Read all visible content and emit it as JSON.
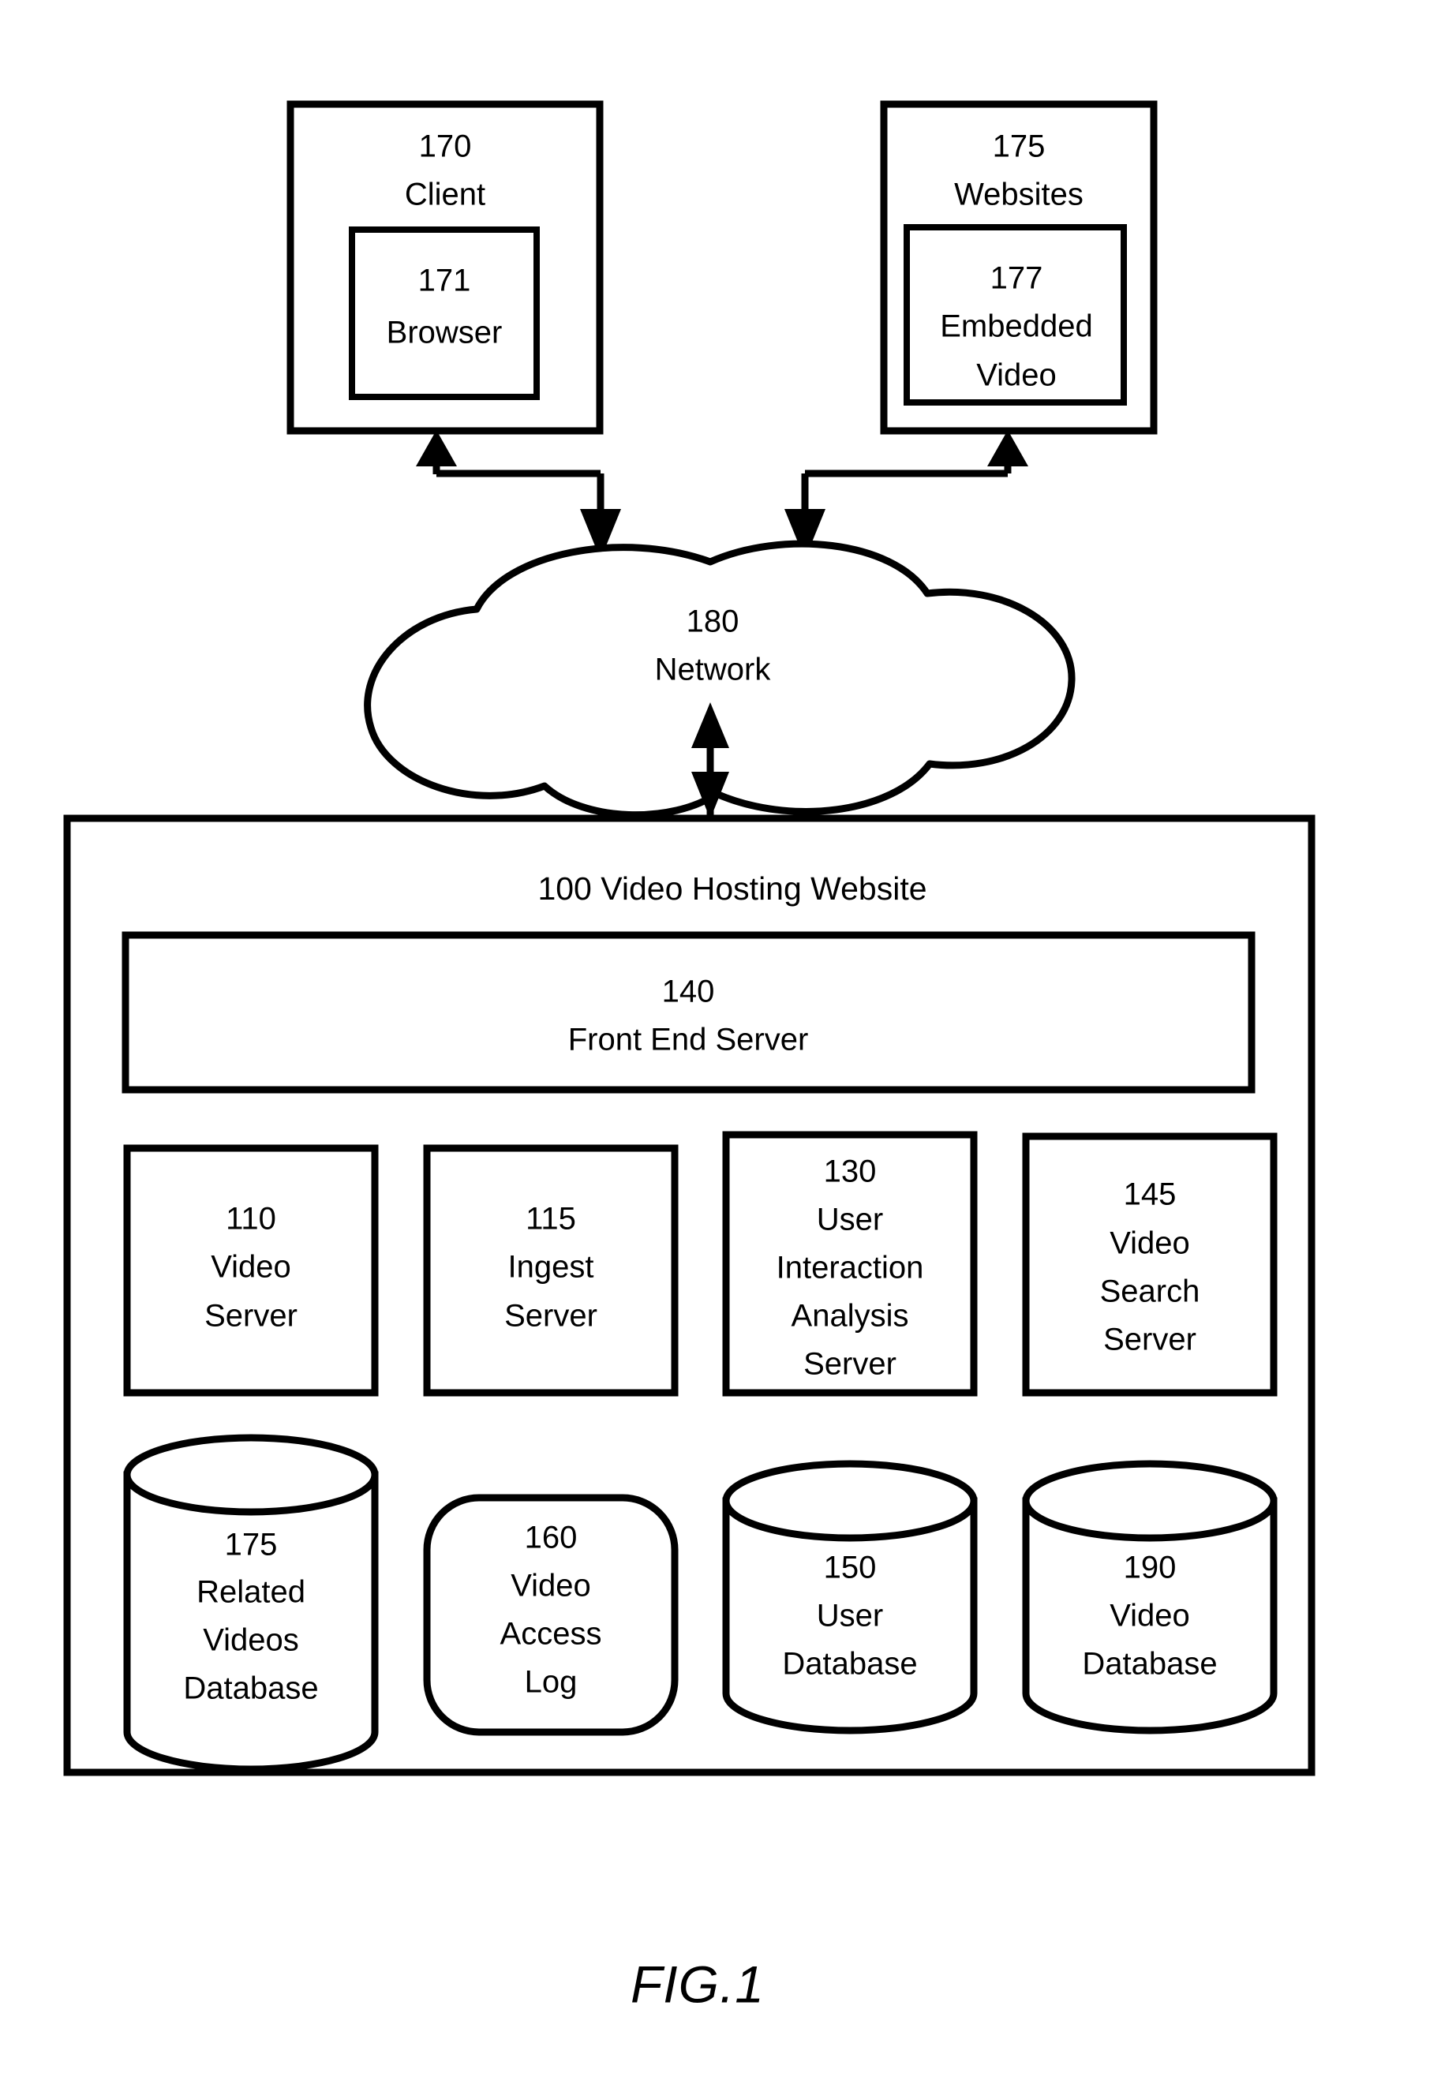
{
  "figure": {
    "caption": "FIG.1"
  },
  "nodes": {
    "client": {
      "ref": "170",
      "label": "Client",
      "inner": {
        "ref": "171",
        "label": "Browser"
      }
    },
    "websites": {
      "ref": "175",
      "label": "Websites",
      "inner": {
        "ref": "177",
        "label_line1": "Embedded",
        "label_line2": "Video"
      }
    },
    "network": {
      "ref": "180",
      "label": "Network"
    },
    "video_hosting_website": {
      "title": "100 Video Hosting Website",
      "front_end_server": {
        "ref": "140",
        "label": "Front End Server"
      },
      "servers": [
        {
          "ref": "110",
          "lines": [
            "Video",
            "Server"
          ]
        },
        {
          "ref": "115",
          "lines": [
            "Ingest",
            "Server"
          ]
        },
        {
          "ref": "130",
          "lines": [
            "User",
            "Interaction",
            "Analysis",
            "Server"
          ]
        },
        {
          "ref": "145",
          "lines": [
            "Video",
            "Search",
            "Server"
          ]
        }
      ],
      "stores": [
        {
          "ref": "175",
          "shape": "cylinder",
          "lines": [
            "Related",
            "Videos",
            "Database"
          ]
        },
        {
          "ref": "160",
          "shape": "rounded-rect",
          "lines": [
            "Video",
            "Access",
            "Log"
          ]
        },
        {
          "ref": "150",
          "shape": "cylinder",
          "lines": [
            "User",
            "Database"
          ]
        },
        {
          "ref": "190",
          "shape": "cylinder",
          "lines": [
            "Video",
            "Database"
          ]
        }
      ]
    }
  },
  "colors": {
    "stroke": "#000000",
    "background": "#ffffff"
  }
}
